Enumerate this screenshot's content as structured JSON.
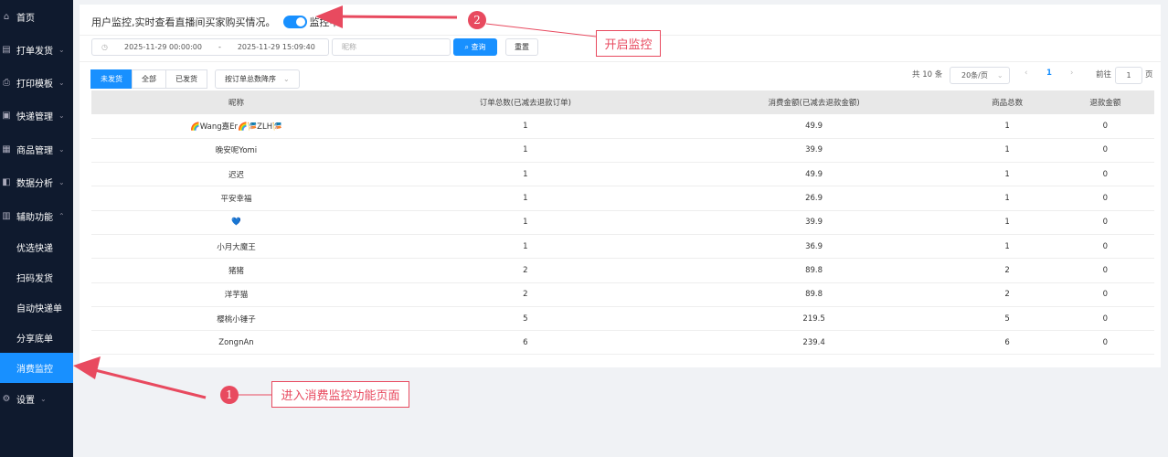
{
  "sidebar": {
    "items": [
      {
        "label": "首页",
        "icon": "home-icon",
        "chev": false
      },
      {
        "label": "打单发货",
        "icon": "print-order-icon",
        "chev": true
      },
      {
        "label": "打印模板",
        "icon": "printer-icon",
        "chev": true
      },
      {
        "label": "快递管理",
        "icon": "express-icon",
        "chev": true
      },
      {
        "label": "商品管理",
        "icon": "goods-icon",
        "chev": true
      },
      {
        "label": "数据分析",
        "icon": "chart-icon",
        "chev": true
      },
      {
        "label": "辅助功能",
        "icon": "tools-icon",
        "chev": true,
        "expanded": true
      }
    ],
    "sub_items": [
      "优选快递",
      "扫码发货",
      "自动快递单",
      "分享底单",
      "消费监控"
    ],
    "active": "消费监控",
    "settings": "设置"
  },
  "header": {
    "description": "用户监控,实时查看直播间买家购买情况。",
    "toggle_on": true,
    "toggle_label": "监控中"
  },
  "filters": {
    "start": "2025-11-29 00:00:00",
    "sep": "-",
    "end": "2025-11-29 15:09:40",
    "nickname_placeholder": "昵称",
    "search": "查询",
    "reset": "重置"
  },
  "tabs": [
    "未发货",
    "全部",
    "已发货"
  ],
  "sort": "按订单总数降序",
  "pagination": {
    "total": "共 10 条",
    "page_size": "20条/页",
    "current": "1",
    "goto": "前往",
    "goto_value": "1",
    "page_unit": "页"
  },
  "table": {
    "columns": [
      "昵称",
      "订单总数(已减去退款订单)",
      "消费金额(已减去退款金额)",
      "商品总数",
      "退款金额"
    ],
    "rows": [
      [
        "🌈Wang嘉Er🌈🎏ZLH🎏",
        "1",
        "49.9",
        "1",
        "0"
      ],
      [
        "晚安呢Yomi",
        "1",
        "39.9",
        "1",
        "0"
      ],
      [
        "迟迟",
        "1",
        "49.9",
        "1",
        "0"
      ],
      [
        "平安幸福",
        "1",
        "26.9",
        "1",
        "0"
      ],
      [
        "💙",
        "1",
        "39.9",
        "1",
        "0"
      ],
      [
        "小月大魔王",
        "1",
        "36.9",
        "1",
        "0"
      ],
      [
        "猪猪",
        "2",
        "89.8",
        "2",
        "0"
      ],
      [
        "洋芋猫",
        "2",
        "89.8",
        "2",
        "0"
      ],
      [
        "樱桃小锤子",
        "5",
        "219.5",
        "5",
        "0"
      ],
      [
        "ZongnAn",
        "6",
        "239.4",
        "6",
        "0"
      ]
    ]
  },
  "annotations": {
    "step1_num": "1",
    "step1_text": "进入消费监控功能页面",
    "step2_num": "2",
    "step2_text": "开启监控",
    "color": "#e84a5f"
  }
}
